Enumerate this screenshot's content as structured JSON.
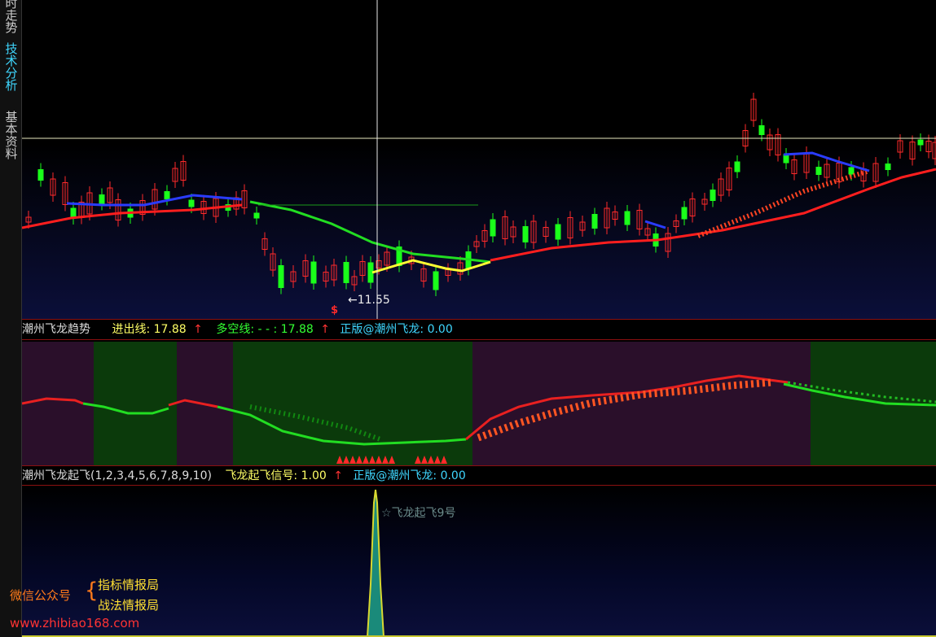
{
  "sidebar": {
    "tabs": [
      {
        "label": "分时走势",
        "visible": "时走势",
        "active": false
      },
      {
        "label": "技术分析",
        "active": true
      },
      {
        "label": "基本资料",
        "active": false
      }
    ]
  },
  "price_panel": {
    "low_marker": "←11.55",
    "signal_marker": "$"
  },
  "trend_bar": {
    "title": "潮州飞龙趋势",
    "entry_label": "进出线: 17.88",
    "bull_bear_label": "多空线: - - : 17.88",
    "edition_label": "正版@潮州飞龙: 0.00",
    "arrow": "↑"
  },
  "takeoff_bar": {
    "title": "潮州飞龙起飞(1,2,3,4,5,6,7,8,9,10)",
    "signal_label": "飞龙起飞信号: 1.00",
    "edition_label": "正版@潮州飞龙: 0.00",
    "arrow": "↑"
  },
  "takeoff_panel": {
    "signal_annotation": "☆飞龙起飞9号"
  },
  "watermark": {
    "wechat": "微信公众号",
    "brace": "{",
    "line1": "指标情报局",
    "line2": "战法情报局",
    "url": "www.zhibiao168.com"
  },
  "colors": {
    "up": "#ff2a2a",
    "down": "#1aff1a",
    "accent": "#3fd7ff",
    "yellow": "#ffff33"
  }
}
